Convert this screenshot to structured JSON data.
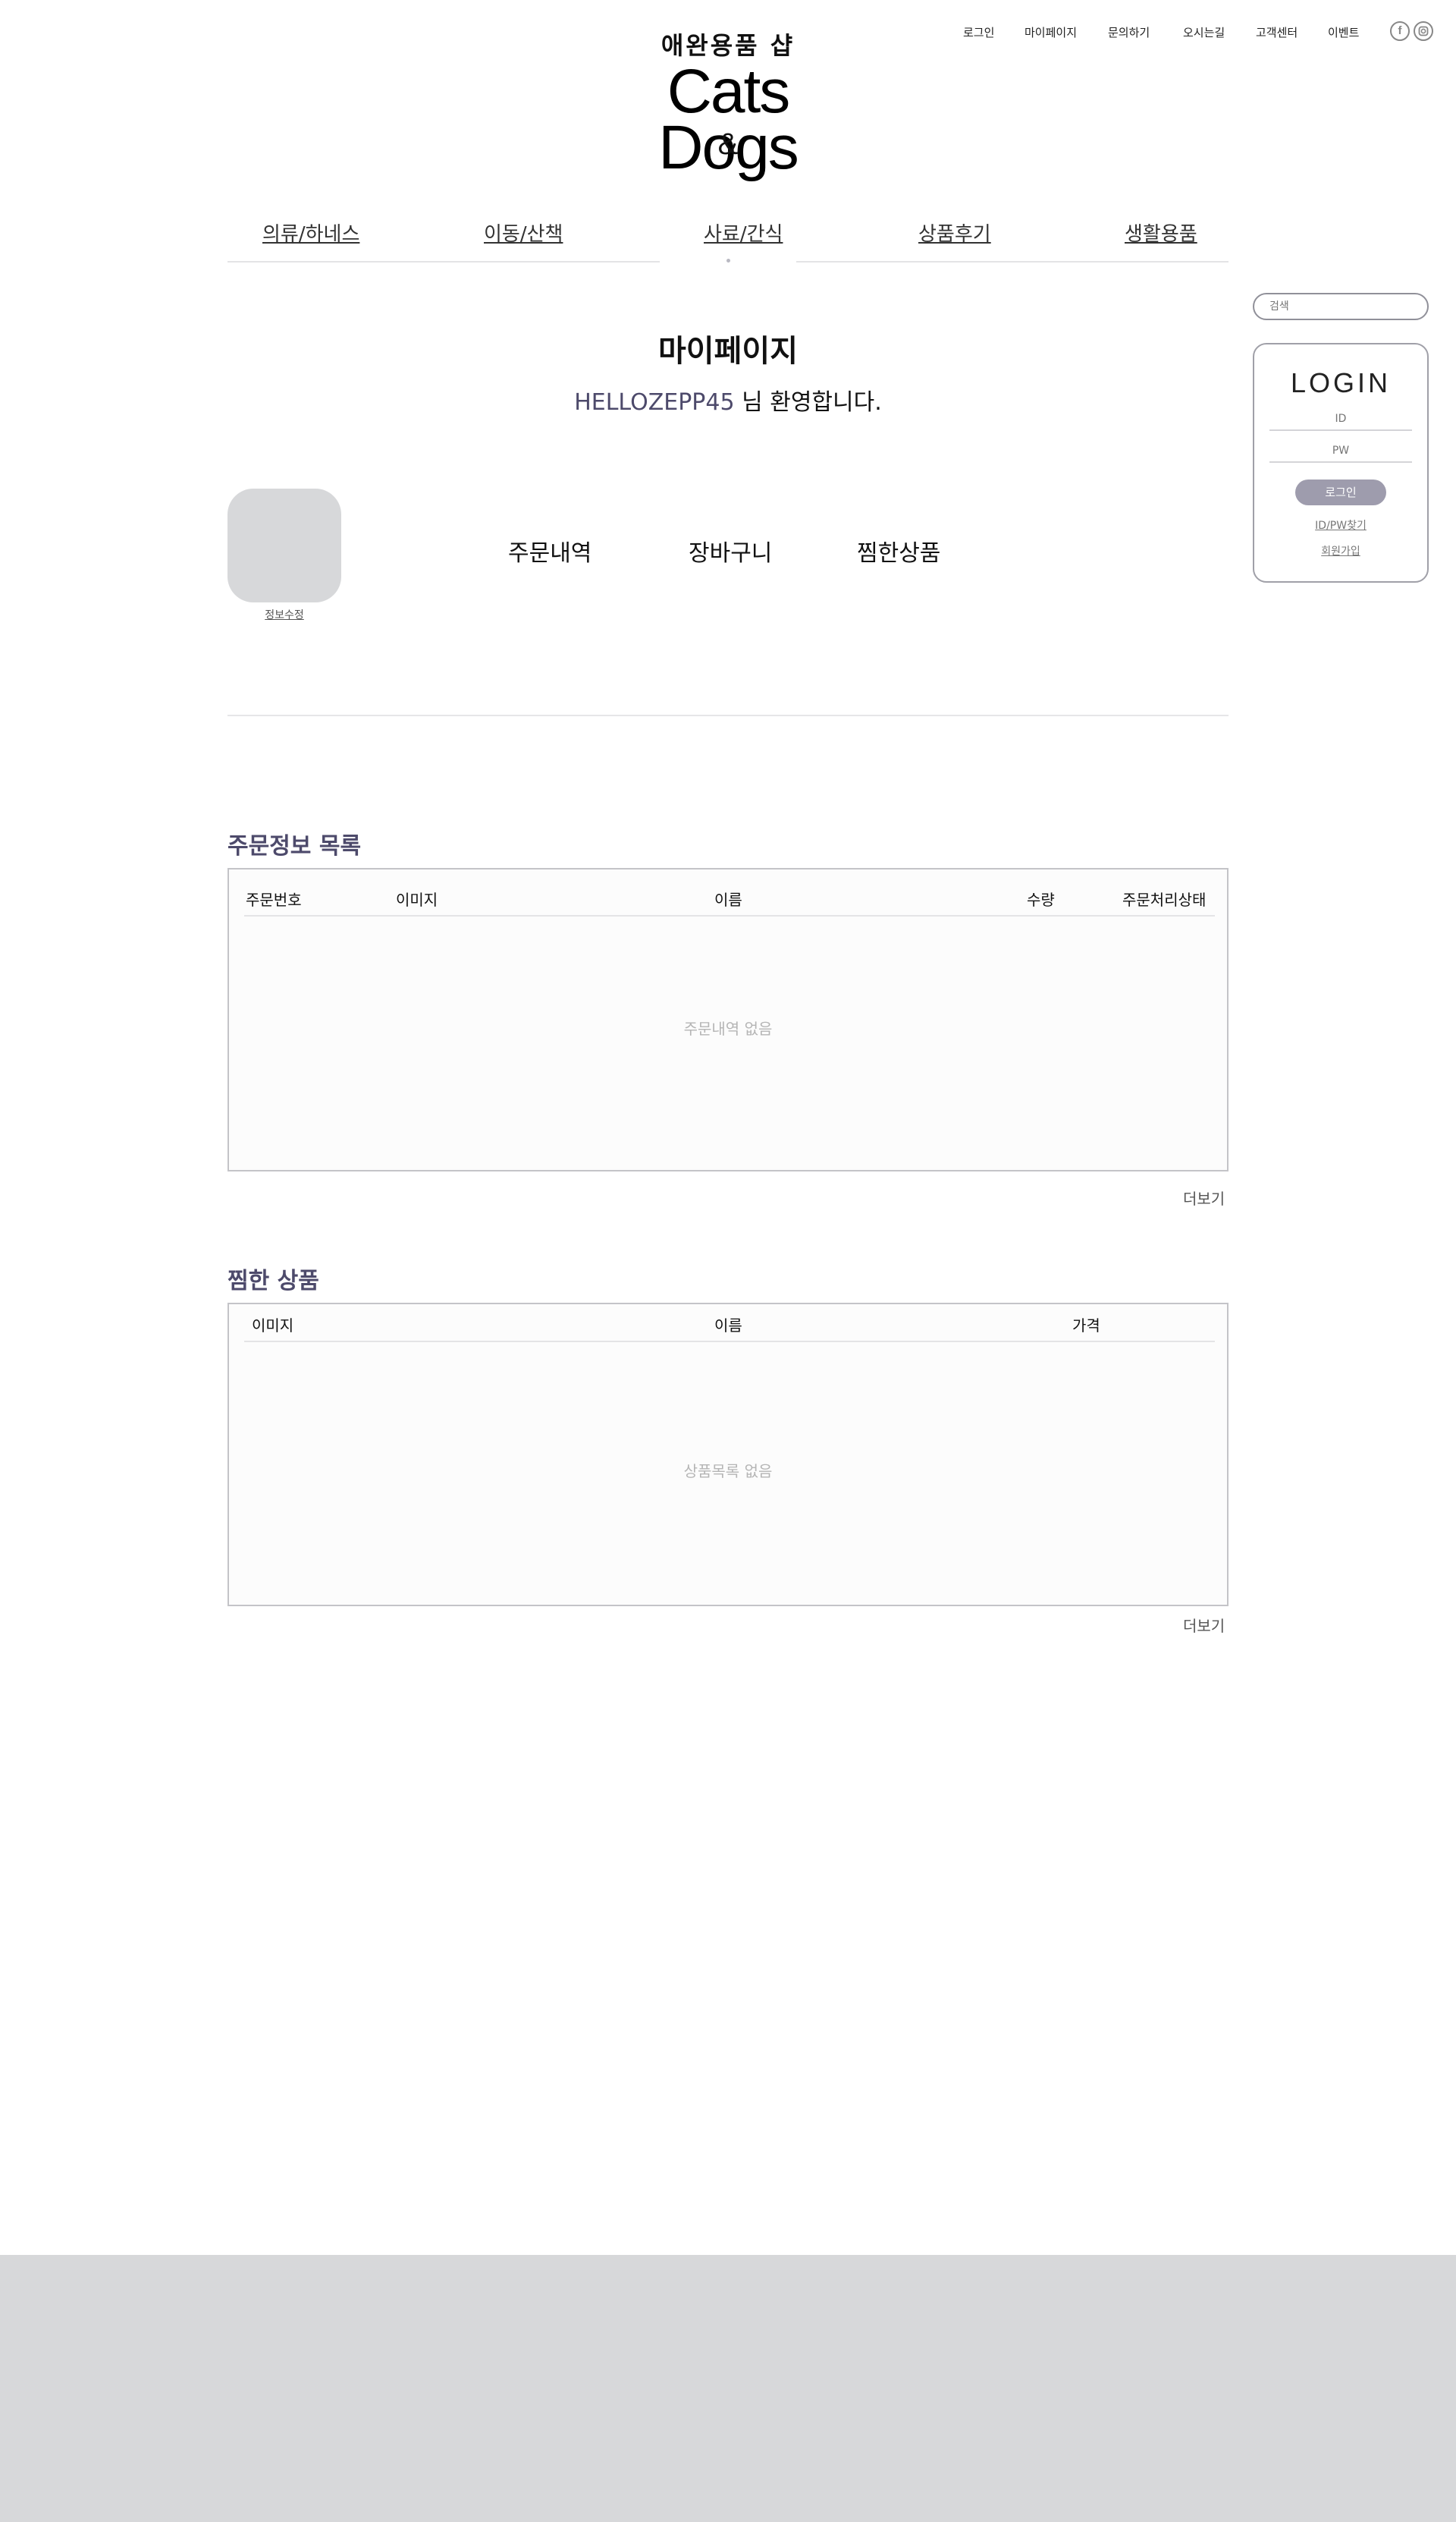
{
  "top_nav": {
    "items": [
      "로그인",
      "마이페이지",
      "문의하기",
      "오시는길",
      "고객센터",
      "이벤트"
    ],
    "social": [
      "facebook-icon",
      "instagram-icon"
    ]
  },
  "logo": {
    "tagline": "애완용품 샵",
    "line1": "Cats",
    "amp": "&",
    "line2": "Dogs"
  },
  "category_nav": {
    "items": [
      "의류/하네스",
      "이동/산책",
      "사료/간식",
      "상품후기",
      "생활용품"
    ],
    "active_index": 2
  },
  "sidebar": {
    "search_placeholder": "검색",
    "login": {
      "title": "LOGIN",
      "id_placeholder": "ID",
      "pw_placeholder": "PW",
      "button": "로그인",
      "find_link": "ID/PW찾기",
      "join_link": "회원가입"
    }
  },
  "main": {
    "page_title": "마이페이지",
    "welcome_user": "HELLOZEPP45",
    "welcome_suffix": " 님 환영합니다.",
    "profile_edit": "정보수정",
    "tabs": [
      "주문내역",
      "장바구니",
      "찜한상품"
    ]
  },
  "orders": {
    "title": "주문정보 목록",
    "columns": [
      "주문번호",
      "이미지",
      "이름",
      "수량",
      "주문처리상태"
    ],
    "empty_text": "주문내역 없음",
    "more": "더보기"
  },
  "wishlist": {
    "title": "찜한 상품",
    "columns": [
      "이미지",
      "이름",
      "가격"
    ],
    "empty_text": "상품목록 없음",
    "more": "더보기"
  },
  "colors": {
    "accent": "#4d4a6b",
    "login_button": "#9e9cad",
    "footer": "#d7d8da",
    "border": "#c4c4c8"
  }
}
